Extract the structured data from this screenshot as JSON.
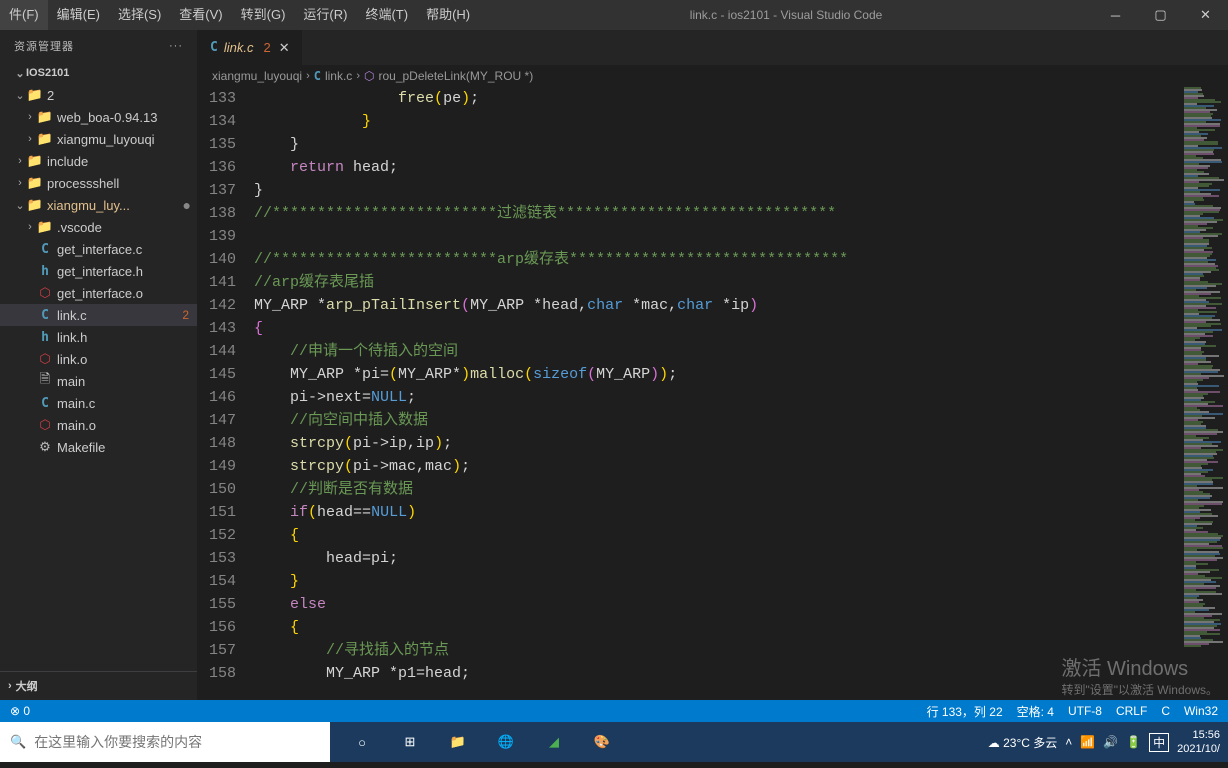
{
  "menu": [
    "件(F)",
    "编辑(E)",
    "选择(S)",
    "查看(V)",
    "转到(G)",
    "运行(R)",
    "终端(T)",
    "帮助(H)"
  ],
  "title": "link.c - ios2101 - Visual Studio Code",
  "sidebar": {
    "header": "资源管理器",
    "root": "IOS2101",
    "outline": "大纲",
    "tree": [
      {
        "chev": "⌄",
        "icon": "📁",
        "iconCls": "folder-icon",
        "label": "2",
        "indent": 0
      },
      {
        "chev": "›",
        "icon": "📁",
        "iconCls": "folder-icon",
        "label": "web_boa-0.94.13",
        "indent": 1
      },
      {
        "chev": "›",
        "icon": "📁",
        "iconCls": "folder-icon",
        "label": "xiangmu_luyouqi",
        "indent": 1
      },
      {
        "chev": "›",
        "icon": "📁",
        "iconCls": "folder-icon",
        "label": "include",
        "indent": 0
      },
      {
        "chev": "›",
        "icon": "📁",
        "iconCls": "folder-icon",
        "label": "processshell",
        "indent": 0
      },
      {
        "chev": "⌄",
        "icon": "📁",
        "iconCls": "folder-icon",
        "label": "xiangmu_luy...",
        "indent": 0,
        "modified": true,
        "dot": true
      },
      {
        "chev": "›",
        "icon": "📁",
        "iconCls": "folder-icon",
        "label": ".vscode",
        "indent": 1
      },
      {
        "chev": "",
        "icon": "C",
        "iconCls": "c-icon",
        "label": "get_interface.c",
        "indent": 1
      },
      {
        "chev": "",
        "icon": "h",
        "iconCls": "h-icon",
        "label": "get_interface.h",
        "indent": 1
      },
      {
        "chev": "",
        "icon": "⬡",
        "iconCls": "o-icon",
        "label": "get_interface.o",
        "indent": 1
      },
      {
        "chev": "",
        "icon": "C",
        "iconCls": "c-icon",
        "label": "link.c",
        "indent": 1,
        "selected": true,
        "badge": "2"
      },
      {
        "chev": "",
        "icon": "h",
        "iconCls": "h-icon",
        "label": "link.h",
        "indent": 1
      },
      {
        "chev": "",
        "icon": "⬡",
        "iconCls": "o-icon",
        "label": "link.o",
        "indent": 1
      },
      {
        "chev": "",
        "icon": "🗎",
        "iconCls": "generic-icon",
        "label": "main",
        "indent": 1
      },
      {
        "chev": "",
        "icon": "C",
        "iconCls": "c-icon",
        "label": "main.c",
        "indent": 1
      },
      {
        "chev": "",
        "icon": "⬡",
        "iconCls": "o-icon",
        "label": "main.o",
        "indent": 1
      },
      {
        "chev": "",
        "icon": "⚙",
        "iconCls": "mk-icon",
        "label": "Makefile",
        "indent": 1
      }
    ]
  },
  "tab": {
    "name": "link.c",
    "badge": "2"
  },
  "breadcrumbs": {
    "b1": "xiangmu_luyouqi",
    "b2": "link.c",
    "b3": "rou_pDeleteLink(MY_ROU *)"
  },
  "code": {
    "startLine": 133,
    "lines": [
      {
        "n": 133,
        "html": "                <span class='f'>free</span><span class='br'>(</span>pe<span class='br'>)</span>;"
      },
      {
        "n": 134,
        "html": "            <span class='br'>}</span>"
      },
      {
        "n": 135,
        "html": "    <span class='p'>}</span>"
      },
      {
        "n": 136,
        "html": "    <span class='k'>return</span> head;"
      },
      {
        "n": 137,
        "html": "<span class='p'>}</span>"
      },
      {
        "n": 138,
        "html": "<span class='c'>//*************************过滤链表*******************************</span>"
      },
      {
        "n": 139,
        "html": ""
      },
      {
        "n": 140,
        "html": "<span class='c'>//*************************arp缓存表*******************************</span>"
      },
      {
        "n": 141,
        "html": "<span class='c'>//arp缓存表尾插</span>"
      },
      {
        "n": 142,
        "html": "MY_ARP *<span class='f'>arp_pTailInsert</span><span class='br2'>(</span>MY_ARP *head,<span class='t'>char</span> *mac,<span class='t'>char</span> *ip<span class='br2'>)</span>"
      },
      {
        "n": 143,
        "html": "<span class='br2'>{</span>"
      },
      {
        "n": 144,
        "html": "    <span class='c'>//申请一个待插入的空间</span>"
      },
      {
        "n": 145,
        "html": "    MY_ARP *pi=<span class='br'>(</span>MY_ARP*<span class='br'>)</span><span class='f'>malloc</span><span class='br'>(</span><span class='t'>sizeof</span><span class='br2'>(</span>MY_ARP<span class='br2'>)</span><span class='br'>)</span>;"
      },
      {
        "n": 146,
        "html": "    pi-&gt;next=<span class='n'>NULL</span>;"
      },
      {
        "n": 147,
        "html": "    <span class='c'>//向空间中插入数据</span>"
      },
      {
        "n": 148,
        "html": "    <span class='f'>strcpy</span><span class='br'>(</span>pi-&gt;ip,ip<span class='br'>)</span>;"
      },
      {
        "n": 149,
        "html": "    <span class='f'>strcpy</span><span class='br'>(</span>pi-&gt;mac,mac<span class='br'>)</span>;"
      },
      {
        "n": 150,
        "html": "    <span class='c'>//判断是否有数据</span>"
      },
      {
        "n": 151,
        "html": "    <span class='k'>if</span><span class='br'>(</span>head==<span class='n'>NULL</span><span class='br'>)</span>"
      },
      {
        "n": 152,
        "html": "    <span class='br'>{</span>"
      },
      {
        "n": 153,
        "html": "        head=pi;"
      },
      {
        "n": 154,
        "html": "    <span class='br'>}</span>"
      },
      {
        "n": 155,
        "html": "    <span class='k'>else</span>"
      },
      {
        "n": 156,
        "html": "    <span class='br'>{</span>"
      },
      {
        "n": 157,
        "html": "        <span class='c'>//寻找插入的节点</span>"
      },
      {
        "n": 158,
        "html": "        MY_ARP *p1=head;"
      }
    ]
  },
  "status": {
    "errors": "0",
    "ln": "行 133，列 22",
    "spaces": "空格: 4",
    "enc": "UTF-8",
    "eol": "CRLF",
    "lang": "C",
    "platform": "Win32"
  },
  "taskbar": {
    "placeholder": "在这里输入你要搜索的内容",
    "weather": "23°C 多云",
    "ime": "中",
    "time": "15:56",
    "date": "2021/10/"
  },
  "activate": {
    "l1": "激活 Windows",
    "l2": "转到\"设置\"以激活 Windows。"
  }
}
